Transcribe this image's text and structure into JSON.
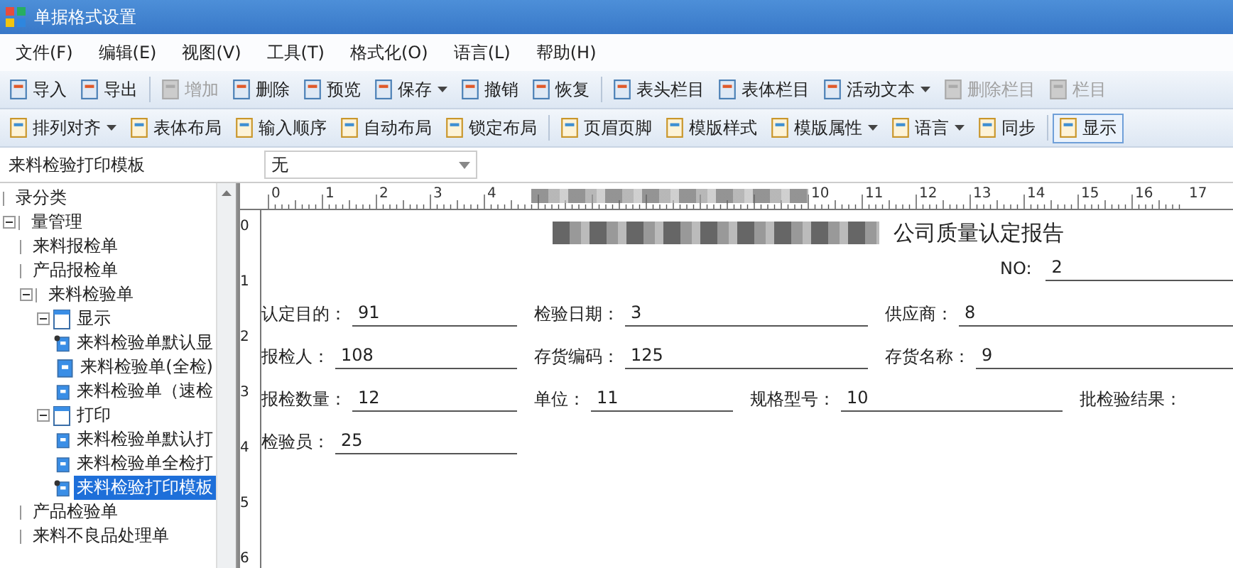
{
  "window": {
    "title": "单据格式设置"
  },
  "menu": [
    "文件(F)",
    "编辑(E)",
    "视图(V)",
    "工具(T)",
    "格式化(O)",
    "语言(L)",
    "帮助(H)"
  ],
  "toolbar_1": [
    {
      "kind": "button",
      "label": "导入",
      "disabled": false,
      "dropdown": false
    },
    {
      "kind": "button",
      "label": "导出",
      "disabled": false,
      "dropdown": false
    },
    {
      "kind": "separator"
    },
    {
      "kind": "button",
      "label": "增加",
      "disabled": true,
      "dropdown": false
    },
    {
      "kind": "button",
      "label": "删除",
      "disabled": false,
      "dropdown": false
    },
    {
      "kind": "button",
      "label": "预览",
      "disabled": false,
      "dropdown": false
    },
    {
      "kind": "button",
      "label": "保存",
      "disabled": false,
      "dropdown": true
    },
    {
      "kind": "button",
      "label": "撤销",
      "disabled": false,
      "dropdown": false
    },
    {
      "kind": "button",
      "label": "恢复",
      "disabled": false,
      "dropdown": false
    },
    {
      "kind": "separator"
    },
    {
      "kind": "button",
      "label": "表头栏目",
      "disabled": false,
      "dropdown": false
    },
    {
      "kind": "button",
      "label": "表体栏目",
      "disabled": false,
      "dropdown": false
    },
    {
      "kind": "button",
      "label": "活动文本",
      "disabled": false,
      "dropdown": true
    },
    {
      "kind": "button",
      "label": "删除栏目",
      "disabled": true,
      "dropdown": false
    },
    {
      "kind": "button",
      "label": "栏目",
      "disabled": true,
      "dropdown": false
    }
  ],
  "toolbar_2": [
    {
      "kind": "button",
      "label": "排列对齐",
      "dropdown": true,
      "pressed": false
    },
    {
      "kind": "button",
      "label": "表体布局",
      "dropdown": false,
      "pressed": false
    },
    {
      "kind": "button",
      "label": "输入顺序",
      "dropdown": false,
      "pressed": false
    },
    {
      "kind": "button",
      "label": "自动布局",
      "dropdown": false,
      "pressed": false
    },
    {
      "kind": "button",
      "label": "锁定布局",
      "dropdown": false,
      "pressed": false
    },
    {
      "kind": "separator"
    },
    {
      "kind": "button",
      "label": "页眉页脚",
      "dropdown": false,
      "pressed": false
    },
    {
      "kind": "button",
      "label": "模版样式",
      "dropdown": false,
      "pressed": false
    },
    {
      "kind": "button",
      "label": "模版属性",
      "dropdown": true,
      "pressed": false
    },
    {
      "kind": "button",
      "label": "语言",
      "dropdown": true,
      "pressed": false
    },
    {
      "kind": "button",
      "label": "同步",
      "dropdown": false,
      "pressed": false
    },
    {
      "kind": "separator"
    },
    {
      "kind": "button",
      "label": "显示",
      "dropdown": false,
      "pressed": true
    }
  ],
  "template_bar": {
    "label": "来料检验打印模板",
    "dropdown_value": "无"
  },
  "tree": [
    {
      "label": "录分类",
      "kind": "node",
      "selected": false
    },
    {
      "label": "量管理",
      "kind": "node",
      "expanded": true,
      "selected": false,
      "children": [
        {
          "label": "来料报检单",
          "kind": "node",
          "selected": false
        },
        {
          "label": "产品报检单",
          "kind": "node",
          "selected": false
        },
        {
          "label": "来料检验单",
          "kind": "node",
          "expanded": true,
          "selected": false,
          "children": [
            {
              "label": "显示",
              "kind": "folder",
              "expanded": true,
              "selected": false,
              "children": [
                {
                  "label": "来料检验单默认显",
                  "kind": "doc",
                  "selected": false,
                  "marked": true
                },
                {
                  "label": "来料检验单(全检)",
                  "kind": "doc",
                  "selected": false,
                  "marked": false
                },
                {
                  "label": "来料检验单（速检",
                  "kind": "doc",
                  "selected": false,
                  "marked": false
                }
              ]
            },
            {
              "label": "打印",
              "kind": "folder",
              "expanded": true,
              "selected": false,
              "children": [
                {
                  "label": "来料检验单默认打",
                  "kind": "doc",
                  "selected": false,
                  "marked": false
                },
                {
                  "label": "来料检验单全检打",
                  "kind": "doc",
                  "selected": false,
                  "marked": false
                },
                {
                  "label": "来料检验打印模板",
                  "kind": "doc",
                  "selected": true,
                  "marked": true
                }
              ]
            }
          ]
        },
        {
          "label": "产品检验单",
          "kind": "node",
          "selected": false
        },
        {
          "label": "来料不良品处理单",
          "kind": "node",
          "selected": false
        }
      ]
    }
  ],
  "ruler": {
    "top_labels": [
      "0",
      "1",
      "2",
      "3",
      "4",
      "10",
      "11",
      "12",
      "13",
      "14",
      "15",
      "16",
      "17"
    ],
    "left_labels": [
      "0",
      "1",
      "2",
      "3",
      "4",
      "5",
      "6"
    ]
  },
  "report": {
    "title": "公司质量认定报告",
    "number_label": "NO:",
    "number_value": "2",
    "rows": [
      [
        {
          "label": "认定目的：",
          "value": "91"
        },
        {
          "label": "检验日期：",
          "value": "3"
        },
        {
          "label": "供应商：",
          "value": "8"
        }
      ],
      [
        {
          "label": "报检人：",
          "value": "108"
        },
        {
          "label": "存货编码：",
          "value": "125"
        },
        {
          "label": "存货名称：",
          "value": "9"
        }
      ],
      [
        {
          "label": "报检数量：",
          "value": "12"
        },
        {
          "label": "单位：",
          "value": "11"
        },
        {
          "label": "规格型号：",
          "value": "10"
        },
        {
          "label": "批检验结果："
        }
      ],
      [
        {
          "label": "检验员：",
          "value": "25"
        }
      ]
    ]
  }
}
